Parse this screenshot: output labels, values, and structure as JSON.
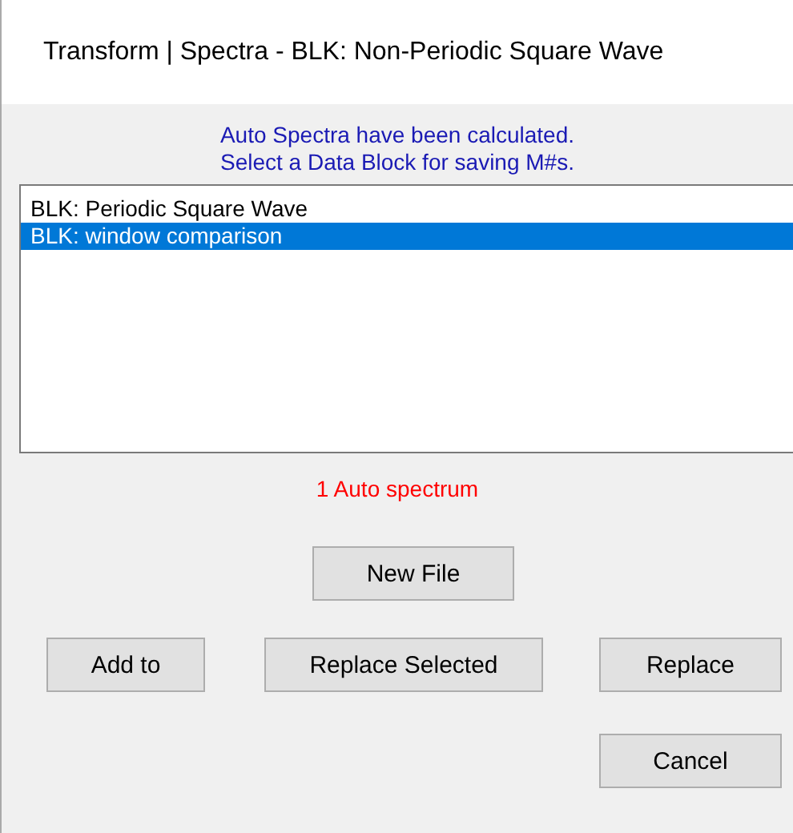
{
  "window": {
    "title": "Transform | Spectra - BLK: Non-Periodic Square Wave"
  },
  "message": [
    "Auto Spectra have been calculated.",
    "Select a Data Block for saving M#s."
  ],
  "blocks": [
    {
      "label": "BLK: Periodic Square Wave",
      "selected": false
    },
    {
      "label": "BLK: window comparison",
      "selected": true
    }
  ],
  "status": "1 Auto spectrum",
  "buttons": {
    "new_file": "New File",
    "add_to": "Add to",
    "replace_selected": "Replace Selected",
    "replace": "Replace",
    "cancel": "Cancel"
  }
}
